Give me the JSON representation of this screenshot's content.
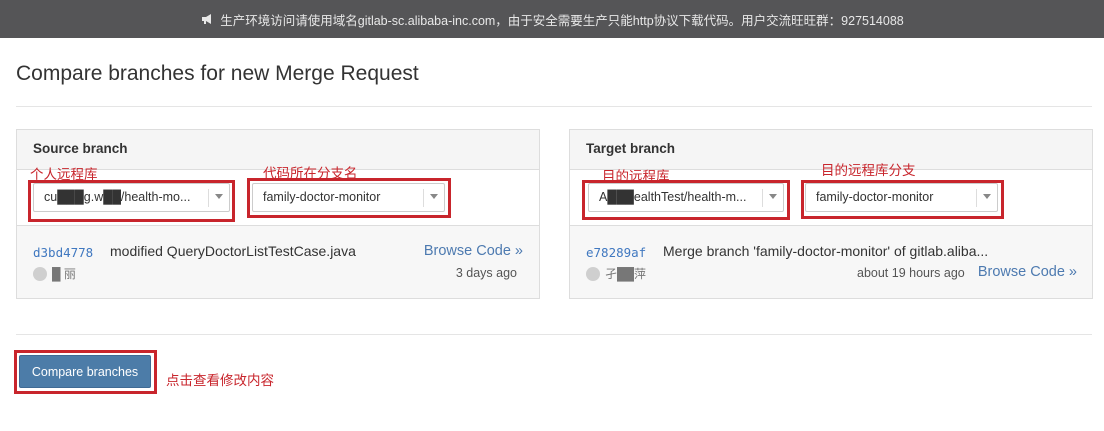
{
  "banner": {
    "icon": "megaphone-icon",
    "text": "生产环境访问请使用域名gitlab-sc.alibaba-inc.com，由于安全需要生产只能http协议下载代码。用户交流旺旺群：927514088"
  },
  "page": {
    "title": "Compare branches for new Merge Request"
  },
  "source": {
    "heading": "Source branch",
    "project_select": "cu███g.w██/health-mo...",
    "branch_select": "family-doctor-monitor",
    "commit": {
      "sha": "d3bd4778",
      "message": "modified QueryDoctorListTestCase.java",
      "author": "█ 丽",
      "time": "3 days ago",
      "browse": "Browse Code »"
    }
  },
  "target": {
    "heading": "Target branch",
    "project_select": "A███ealthTest/health-m...",
    "branch_select": "family-doctor-monitor",
    "commit": {
      "sha": "e78289af",
      "message": "Merge branch 'family-doctor-monitor' of gitlab.aliba...",
      "author": "孑██萍",
      "time": "about 19 hours ago",
      "browse": "Browse Code »"
    }
  },
  "annotations": {
    "source_project": "个人远程库",
    "source_branch": "代码所在分支名",
    "target_project": "目的远程库",
    "target_branch": "目的远程库分支",
    "compare": "点击查看修改内容",
    "color": "#c8252c"
  },
  "actions": {
    "compare_label": "Compare branches",
    "compare_color": "#4c7ca8"
  }
}
